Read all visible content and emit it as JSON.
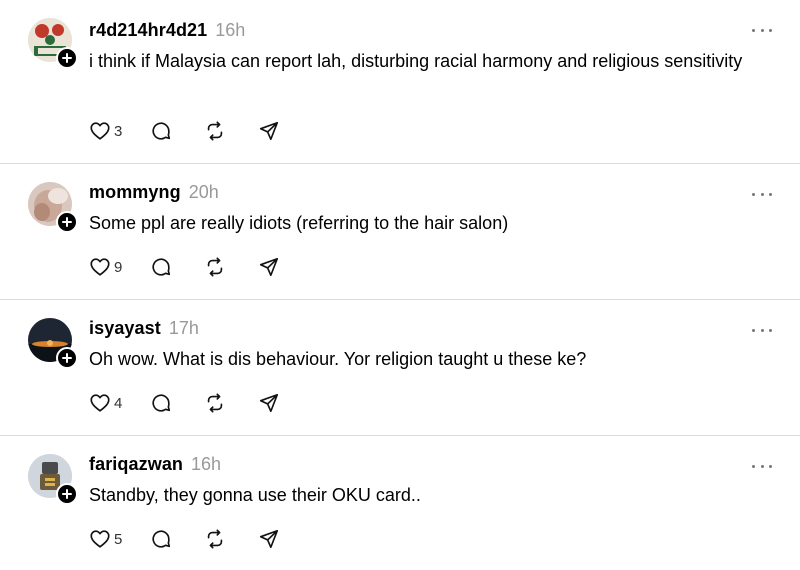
{
  "posts": [
    {
      "username": "r4d214hr4d21",
      "time": "16h",
      "text": "i think if Malaysia can report lah, disturbing racial harmony and religious sensitivity",
      "likes": "3"
    },
    {
      "username": "mommyng",
      "time": "20h",
      "text": "Some ppl are really idiots (referring to the hair salon)",
      "likes": "9"
    },
    {
      "username": "isyayast",
      "time": "17h",
      "text": "Oh wow. What is dis behaviour. Yor religion taught u these ke?",
      "likes": "4"
    },
    {
      "username": "fariqazwan",
      "time": "16h",
      "text": "Standby, they gonna use their OKU card..",
      "likes": "5"
    }
  ],
  "icons": {
    "like": "heart-icon",
    "reply": "comment-icon",
    "repost": "repost-icon",
    "share": "send-icon",
    "more": "more-icon",
    "follow": "plus-icon"
  }
}
